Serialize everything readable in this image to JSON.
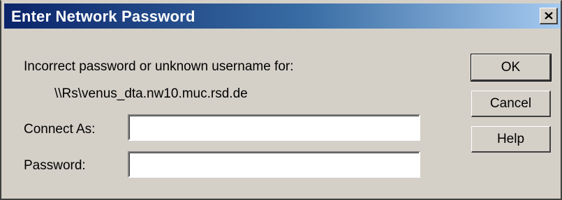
{
  "window": {
    "title": "Enter Network Password",
    "close_glyph": "×"
  },
  "message": {
    "prompt": "Incorrect password or unknown username for:",
    "resource": "\\\\Rs\\venus_dta.nw10.muc.rsd.de"
  },
  "form": {
    "connect_as_label": "Connect As:",
    "connect_as_value": "",
    "password_label": "Password:",
    "password_value": ""
  },
  "buttons": {
    "ok": "OK",
    "cancel": "Cancel",
    "help": "Help"
  },
  "colors": {
    "face": "#d4d0c8",
    "title_start": "#0a246a",
    "title_end": "#a6caf0",
    "title_text": "#ffffff"
  },
  "icons": {
    "close": "close-icon"
  }
}
